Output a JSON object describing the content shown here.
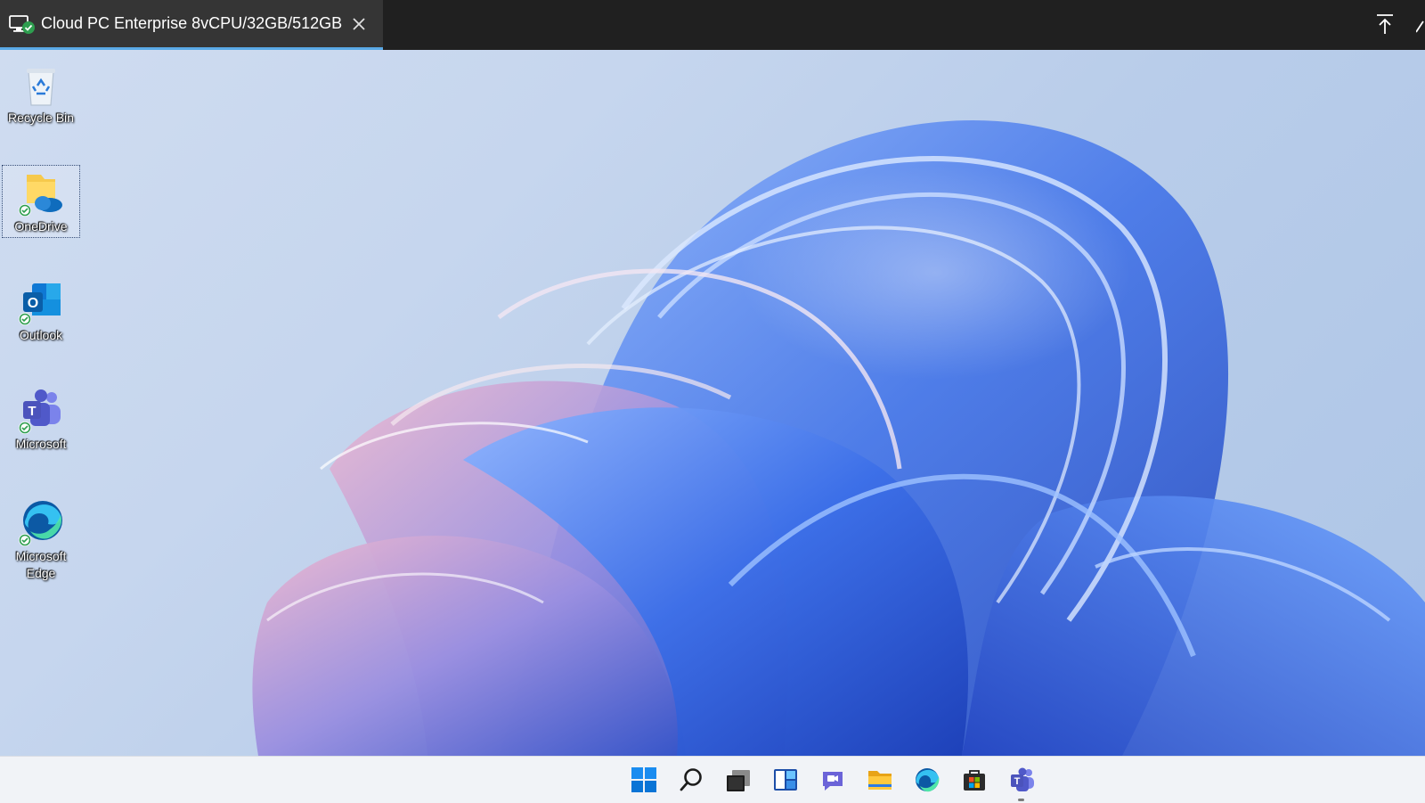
{
  "session_tab": {
    "title": "Cloud PC Enterprise 8vCPU/32GB/512GB",
    "icon": "monitor-check-icon",
    "close_icon": "close-icon"
  },
  "toolbar": {
    "pin_icon": "pin-to-top-icon"
  },
  "desktop": {
    "icons": [
      {
        "label": "Recycle Bin",
        "icon": "recycle-bin-icon",
        "synced": false
      },
      {
        "label": "OneDrive",
        "icon": "onedrive-folder-icon",
        "synced": true,
        "selected": true
      },
      {
        "label": "Outlook",
        "icon": "outlook-icon",
        "synced": true
      },
      {
        "label": "Microsoft",
        "icon": "teams-icon",
        "synced": true
      },
      {
        "label": "Microsoft Edge",
        "icon": "edge-icon",
        "synced": true
      }
    ]
  },
  "taskbar": {
    "items": [
      {
        "name": "Start",
        "icon": "windows-start-icon"
      },
      {
        "name": "Search",
        "icon": "search-icon"
      },
      {
        "name": "Task View",
        "icon": "task-view-icon"
      },
      {
        "name": "Widgets",
        "icon": "widgets-icon"
      },
      {
        "name": "Chat",
        "icon": "chat-icon"
      },
      {
        "name": "File Explorer",
        "icon": "file-explorer-icon"
      },
      {
        "name": "Microsoft Edge",
        "icon": "edge-icon"
      },
      {
        "name": "Microsoft Store",
        "icon": "store-icon"
      },
      {
        "name": "Microsoft Teams",
        "icon": "teams-icon",
        "running": true
      }
    ]
  },
  "colors": {
    "tab_background": "#353535",
    "tab_underline": "#5aa9e6",
    "titlebar": "#202020",
    "taskbar": "#f1f3f7",
    "sync_check": "#2e9e4f",
    "windows_blue": "#0078d4"
  }
}
